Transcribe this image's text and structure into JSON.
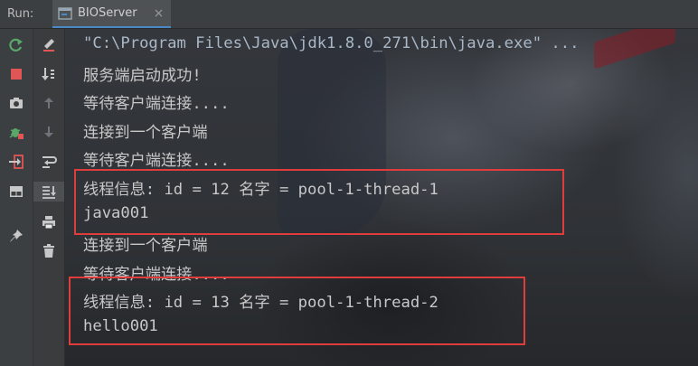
{
  "toolbar": {
    "run_label": "Run:"
  },
  "tab": {
    "label": "BIOServer",
    "close": "×"
  },
  "gutter_left": [
    {
      "icon": "rerun-icon"
    },
    {
      "icon": "stop-icon"
    },
    {
      "icon": "camera-icon"
    },
    {
      "icon": "debug-bug-icon"
    },
    {
      "icon": "exit-icon"
    },
    {
      "icon": "layout-icon"
    },
    {
      "icon": "pin-icon"
    }
  ],
  "gutter_right": [
    {
      "icon": "clear-icon"
    },
    {
      "icon": "sort-icon"
    },
    {
      "icon": "up-arrow-icon"
    },
    {
      "icon": "down-arrow-icon"
    },
    {
      "icon": "soft-wrap-icon"
    },
    {
      "icon": "scroll-to-end-icon"
    },
    {
      "icon": "print-icon"
    },
    {
      "icon": "trash-icon"
    }
  ],
  "console": {
    "lines": [
      "\"C:\\Program Files\\Java\\jdk1.8.0_271\\bin\\java.exe\" ...",
      "服务端启动成功!",
      "等待客户端连接....",
      "连接到一个客户端",
      "等待客户端连接....",
      "线程信息: id = 12 名字 = pool-1-thread-1",
      "java001",
      "连接到一个客户端",
      "等待客户端连接....",
      "线程信息: id = 13 名字 = pool-1-thread-2",
      "hello001"
    ]
  },
  "colors": {
    "highlight": "#e03c3c",
    "tab_underline": "#4a88c7",
    "rerun": "#59a869",
    "stop": "#e05555"
  }
}
